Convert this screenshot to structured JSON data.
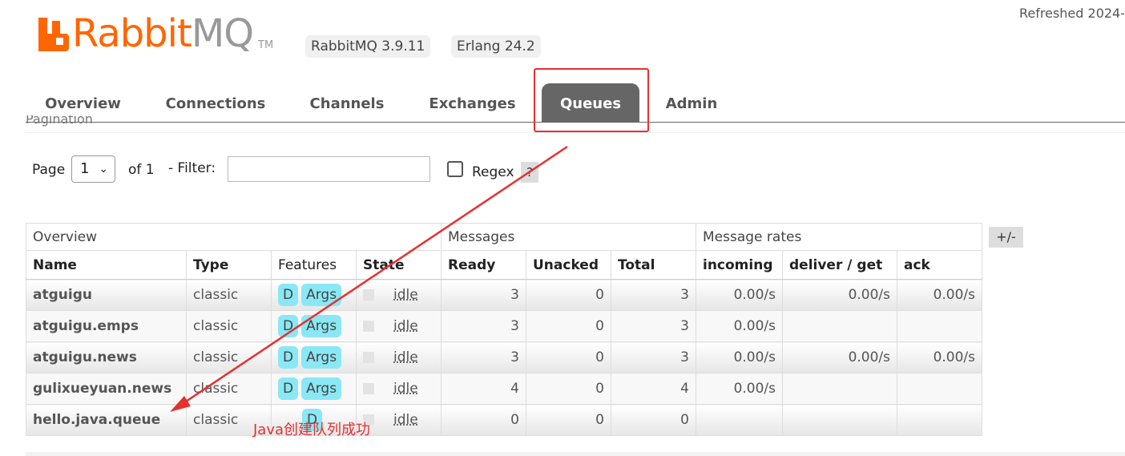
{
  "header": {
    "logo_brand": "Rabbit",
    "logo_mq": "MQ",
    "logo_tm": "TM",
    "rabbitmq_version": "RabbitMQ 3.9.11",
    "erlang_version": "Erlang 24.2",
    "refreshed": "Refreshed 2024-"
  },
  "tabs": [
    {
      "label": "Overview"
    },
    {
      "label": "Connections"
    },
    {
      "label": "Channels"
    },
    {
      "label": "Exchanges"
    },
    {
      "label": "Queues",
      "active": true
    },
    {
      "label": "Admin"
    }
  ],
  "section": {
    "pagination_label": "Pagination"
  },
  "pagination": {
    "page_label": "Page",
    "page_value": "1",
    "of_label": "of 1",
    "filter_label": "- Filter:",
    "filter_value": "",
    "regex_label": "Regex",
    "help_label": "?"
  },
  "table": {
    "groups": {
      "overview": "Overview",
      "messages": "Messages",
      "message_rates": "Message rates"
    },
    "columns": {
      "name": "Name",
      "type": "Type",
      "features": "Features",
      "state": "State",
      "ready": "Ready",
      "unacked": "Unacked",
      "total": "Total",
      "incoming": "incoming",
      "deliver_get": "deliver / get",
      "ack": "ack"
    },
    "toggle_label": "+/-",
    "rows": [
      {
        "name": "atguigu",
        "type": "classic",
        "feature_d": "D",
        "feature_args": "Args",
        "state": "idle",
        "ready": "3",
        "unacked": "0",
        "total": "3",
        "incoming": "0.00/s",
        "deliver_get": "0.00/s",
        "ack": "0.00/s"
      },
      {
        "name": "atguigu.emps",
        "type": "classic",
        "feature_d": "D",
        "feature_args": "Args",
        "state": "idle",
        "ready": "3",
        "unacked": "0",
        "total": "3",
        "incoming": "0.00/s",
        "deliver_get": "",
        "ack": ""
      },
      {
        "name": "atguigu.news",
        "type": "classic",
        "feature_d": "D",
        "feature_args": "Args",
        "state": "idle",
        "ready": "3",
        "unacked": "0",
        "total": "3",
        "incoming": "0.00/s",
        "deliver_get": "0.00/s",
        "ack": "0.00/s"
      },
      {
        "name": "gulixueyuan.news",
        "type": "classic",
        "feature_d": "D",
        "feature_args": "Args",
        "state": "idle",
        "ready": "4",
        "unacked": "0",
        "total": "4",
        "incoming": "0.00/s",
        "deliver_get": "",
        "ack": ""
      },
      {
        "name": "hello.java.queue",
        "type": "classic",
        "feature_d": "D",
        "feature_args": "",
        "state": "idle",
        "ready": "0",
        "unacked": "0",
        "total": "0",
        "incoming": "",
        "deliver_get": "",
        "ack": ""
      }
    ]
  },
  "annotation": {
    "text": "Java创建队列成功",
    "color": "#e63030"
  },
  "colors": {
    "brand": "#ff6600",
    "active_tab": "#666666",
    "feature_badge": "#8ae8f5"
  }
}
